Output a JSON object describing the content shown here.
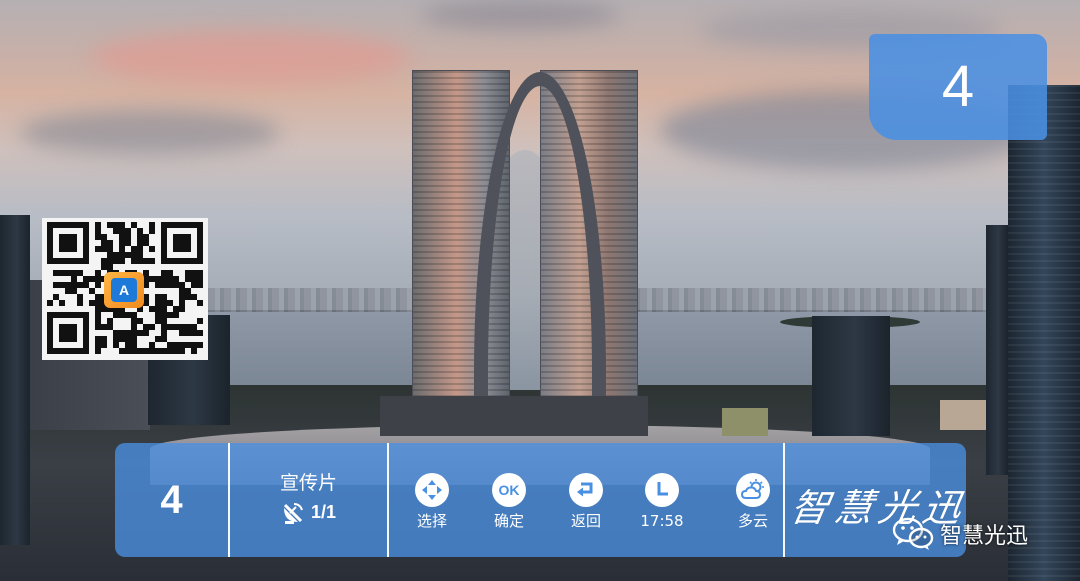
{
  "channel_indicator": {
    "number": "4"
  },
  "info_bar": {
    "channel_number": "4",
    "program": {
      "title": "宣传片",
      "page": "1/1"
    },
    "keys": [
      {
        "icon": "direction-pad-icon",
        "label": "选择"
      },
      {
        "icon": "ok-icon",
        "symbol": "OK",
        "label": "确定"
      },
      {
        "icon": "return-icon",
        "label": "返回"
      },
      {
        "icon": "clock-icon",
        "label": "17:58"
      },
      {
        "icon": "cloudy-weather-icon",
        "label": "多云"
      }
    ],
    "brand_calligraphy": "智慧光迅"
  },
  "qr_code": {
    "logo_text": "A"
  },
  "watermark": {
    "icon": "wechat-icon",
    "text": "智慧光迅"
  },
  "colors": {
    "accent": "#4A90E2",
    "text": "#FFFFFF"
  }
}
